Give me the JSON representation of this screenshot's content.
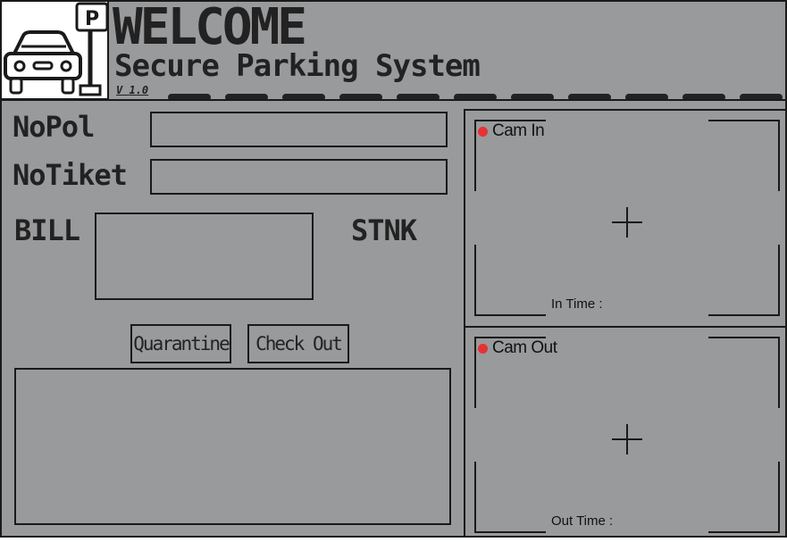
{
  "header": {
    "title": "WELCOME",
    "subtitle": "Secure Parking System",
    "version": "V 1.0",
    "logo_icon": "parking-car-icon",
    "parking_sign_letter": "P"
  },
  "form": {
    "nopol_label": "NoPol",
    "nopol_value": "",
    "notiket_label": "NoTiket",
    "notiket_value": "",
    "bill_label": "BILL",
    "stnk_label": "STNK"
  },
  "buttons": {
    "quarantine": "Quarantine",
    "checkout": "Check Out"
  },
  "cameras": {
    "in": {
      "label": "Cam In",
      "time_label": "In Time :"
    },
    "out": {
      "label": "Cam Out",
      "time_label": "Out Time :"
    },
    "rec_color": "#e63232"
  },
  "colors": {
    "panel_bg": "#999a9c",
    "border": "#1a1a1a"
  }
}
